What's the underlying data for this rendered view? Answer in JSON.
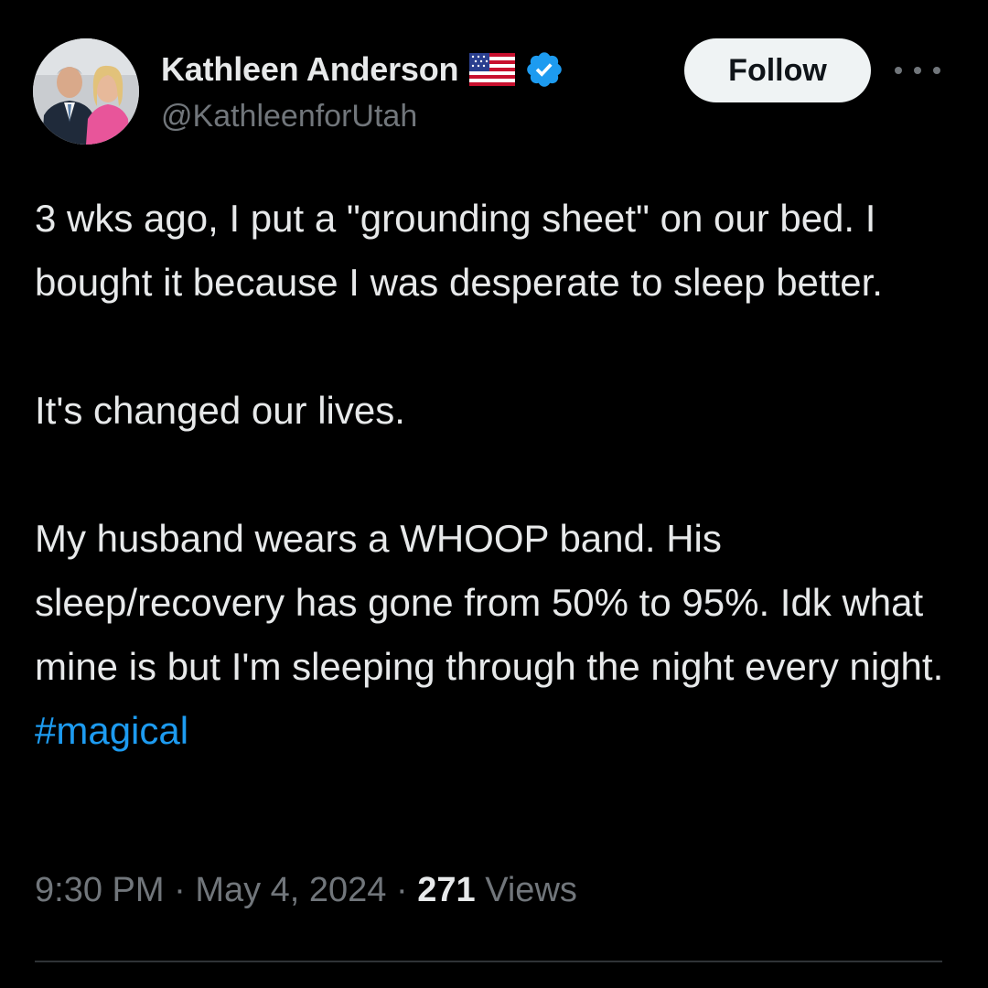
{
  "author": {
    "display_name": "Kathleen Anderson",
    "handle": "@KathleenforUtah",
    "verified": true,
    "flag_icon": "us-flag-icon",
    "verified_icon": "verified-badge-icon",
    "verified_color": "#1d9bf0"
  },
  "actions": {
    "follow_label": "Follow",
    "more_icon": "more-options-icon"
  },
  "tweet": {
    "paragraphs": [
      "3 wks ago, I put a \"grounding sheet\" on our bed. I bought it because I was desperate to sleep better.",
      "It's changed our lives.",
      "My husband wears a WHOOP band. His sleep/recovery has gone from 50% to 95%. Idk what mine is but I'm sleeping through the night every night."
    ],
    "hashtag": "#magical",
    "time": "9:30 PM",
    "separator": "·",
    "date": "May 4, 2024",
    "views_count": "271",
    "views_label": "Views"
  },
  "colors": {
    "background": "#000000",
    "text": "#e7e9ea",
    "secondary_text": "#71767b",
    "link": "#1d9bf0",
    "follow_bg": "#eff3f4"
  }
}
